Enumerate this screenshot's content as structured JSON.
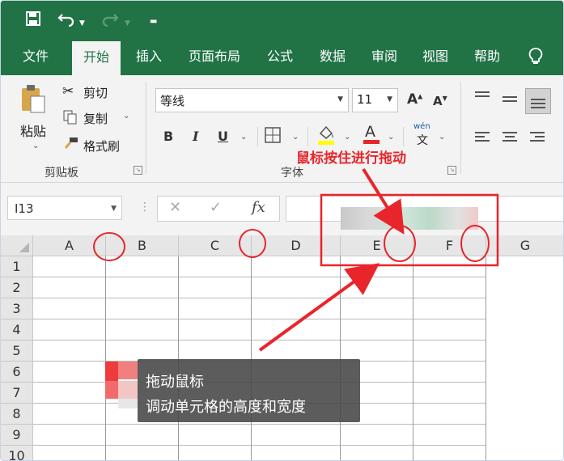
{
  "qat": {
    "icons": [
      "save-icon",
      "undo-icon",
      "redo-icon",
      "customize-icon"
    ]
  },
  "tabs": [
    "文件",
    "开始",
    "插入",
    "页面布局",
    "公式",
    "数据",
    "审阅",
    "视图",
    "帮助"
  ],
  "active_tab": "开始",
  "ribbon": {
    "paste_label": "粘贴",
    "cut_label": "剪切",
    "copy_label": "复制",
    "format_painter_label": "格式刷",
    "clipboard_group": "剪贴板",
    "font_name": "等线",
    "font_size": "11",
    "bold": "B",
    "italic": "I",
    "underline": "U",
    "phonetic": "wén",
    "font_group": "字体"
  },
  "formula_bar": {
    "name_box": "I13",
    "fx_label": "fx",
    "cancel_glyph": "✕",
    "enter_glyph": "✓"
  },
  "columns": [
    "A",
    "B",
    "C",
    "D",
    "E",
    "F",
    "G"
  ],
  "rows": [
    "1",
    "2",
    "3",
    "4",
    "5",
    "6",
    "7",
    "8",
    "9",
    "10"
  ],
  "annotation_drag": "鼠标按住进行拖动",
  "tooltip": {
    "line1": "拖动鼠标",
    "line2": "调动单元格的高度和宽度"
  },
  "colors": {
    "excel_green": "#217346",
    "annotation_red": "#e8252b"
  }
}
